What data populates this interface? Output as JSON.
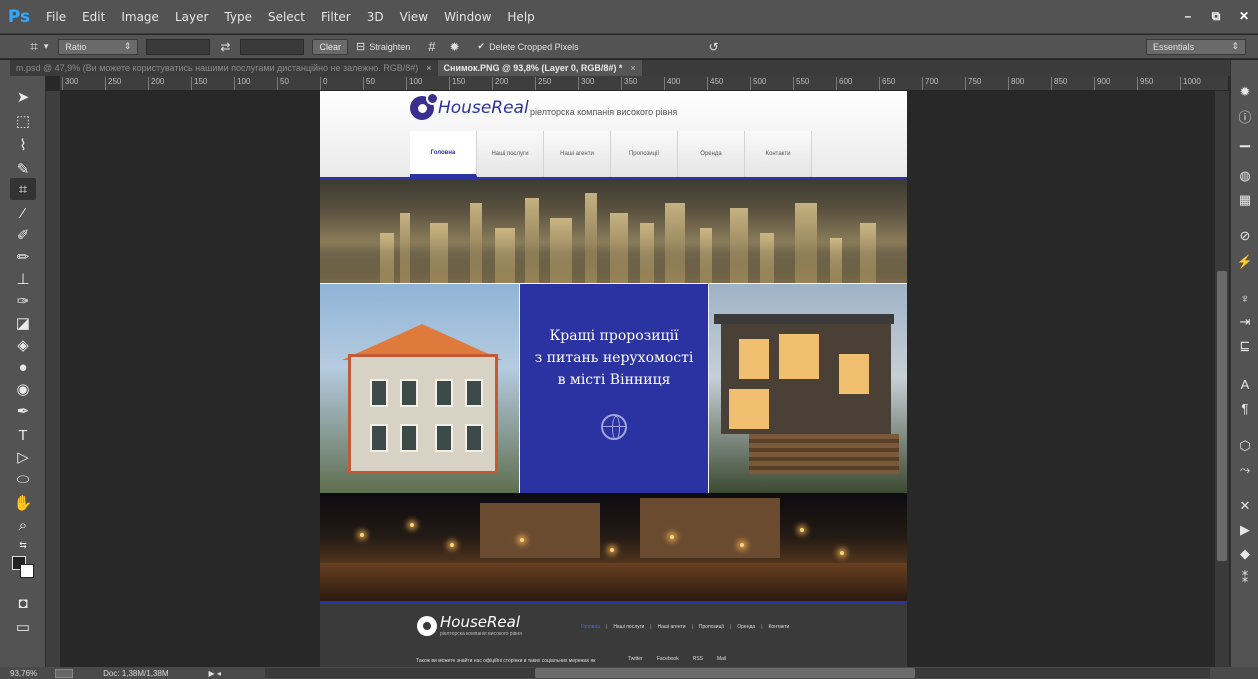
{
  "app": {
    "logo": "Ps",
    "menu": [
      "File",
      "Edit",
      "Image",
      "Layer",
      "Type",
      "Select",
      "Filter",
      "3D",
      "View",
      "Window",
      "Help"
    ],
    "window_controls": [
      "–",
      "⧉",
      "✕"
    ]
  },
  "options_bar": {
    "ratio_label": "Ratio",
    "clear_label": "Clear",
    "straighten_label": "Straighten",
    "delete_cropped_label": "Delete Cropped Pixels",
    "workspace": "Essentials"
  },
  "tabs": [
    {
      "label": "m.psd @ 47,9% (Ви можете користуватись нашими послугами дистанційно не залежно. RGB/8#)",
      "active": false
    },
    {
      "label": "Снимок.PNG @ 93,8% (Layer 0, RGB/8#) *",
      "active": true
    }
  ],
  "ruler_ticks": [
    "300",
    "250",
    "200",
    "150",
    "100",
    "50",
    "0",
    "50",
    "100",
    "150",
    "200",
    "250",
    "300",
    "350",
    "400",
    "450",
    "500",
    "550",
    "600",
    "650",
    "700",
    "750",
    "800",
    "850",
    "900",
    "950",
    "1000"
  ],
  "status": {
    "zoom": "93,76%",
    "doc": "Doc: 1,38M/1,38M"
  },
  "site": {
    "logo_text": "HouseReal",
    "tagline": "ріелторска компанія високого рівня",
    "nav": [
      "Головна",
      "Наші послуги",
      "Наші агенти",
      "Пропозиції",
      "Оренда",
      "Контакти"
    ],
    "promo_line1": "Кращі пророзиції",
    "promo_line2": "з питань нерухомості",
    "promo_line3": "в місті Вінниця",
    "footer_logo_text": "HouseReal",
    "footer_tagline": "ріелторска компанія високого рівня",
    "footer_nav": [
      "Головна",
      "Наші послуги",
      "Наші агенти",
      "Пропозиції",
      "Оренда",
      "Контакти"
    ],
    "footer_text": "Також ви можете знайти нас офіційні сторінки в таких соціальних мережах як",
    "social": [
      "Twitter",
      "Facebook",
      "RSS",
      "Mail"
    ]
  },
  "colors": {
    "brand_blue": "#2b32a2",
    "ps_blue": "#31a8ff",
    "chrome": "#535353"
  }
}
